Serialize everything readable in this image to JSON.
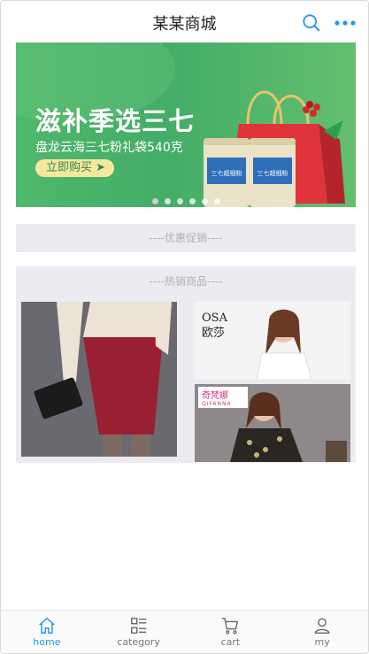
{
  "header": {
    "title": "某某商城"
  },
  "banner": {
    "headline": "滋补季选三七",
    "subline": "盘龙云海三七粉礼袋540克",
    "cta": "立即购买 ➤",
    "jar_label": "三七超细粉",
    "dot_count": 6,
    "active_dot": 0
  },
  "sections": {
    "promotion": "----优惠促销----",
    "hot": "----热销商品----"
  },
  "products": {
    "p2_brand": "OSA 欧莎",
    "p3_brand": "奇梵娜",
    "p3_brand_en": "QIFANNA"
  },
  "tabs": [
    {
      "label": "home",
      "icon": "home-icon",
      "active": true
    },
    {
      "label": "category",
      "icon": "category-icon",
      "active": false
    },
    {
      "label": "cart",
      "icon": "cart-icon",
      "active": false
    },
    {
      "label": "my",
      "icon": "user-icon",
      "active": false
    }
  ],
  "colors": {
    "accent": "#2196f3",
    "banner_green": "#43ad67",
    "section_bg": "#ebebf1"
  }
}
